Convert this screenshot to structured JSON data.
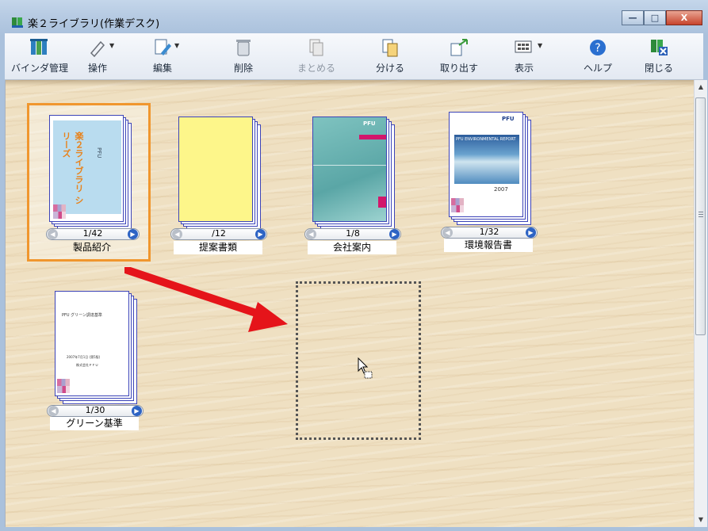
{
  "window": {
    "title": "楽２ライブラリ(作業デスク)",
    "buttons": {
      "minimize": "—",
      "maximize": "□",
      "close": "X"
    }
  },
  "toolbar": {
    "items": [
      {
        "label": "バインダ管理",
        "icon": "binder-icon",
        "enabled": true
      },
      {
        "label": "操作",
        "icon": "wand-icon",
        "enabled": true
      },
      {
        "label": "編集",
        "icon": "edit-icon",
        "enabled": true
      },
      {
        "label": "削除",
        "icon": "trash-icon",
        "enabled": true
      },
      {
        "label": "まとめる",
        "icon": "merge-icon",
        "enabled": false
      },
      {
        "label": "分ける",
        "icon": "split-icon",
        "enabled": true
      },
      {
        "label": "取り出す",
        "icon": "extract-icon",
        "enabled": true
      },
      {
        "label": "表示",
        "icon": "view-icon",
        "enabled": true
      },
      {
        "label": "ヘルプ",
        "icon": "help-icon",
        "enabled": true
      },
      {
        "label": "閉じる",
        "icon": "close-desk-icon",
        "enabled": true
      }
    ]
  },
  "binders": [
    {
      "name": "製品紹介",
      "pages": "1/42",
      "selected": true
    },
    {
      "name": "提案書類",
      "pages": "/12",
      "selected": false
    },
    {
      "name": "会社案内",
      "pages": "1/8",
      "selected": false
    },
    {
      "name": "環境報告書",
      "pages": "1/32",
      "selected": false
    },
    {
      "name": "グリーン基準",
      "pages": "1/30",
      "selected": false
    }
  ],
  "covers": {
    "product_vertical": "楽２ライブラリ シリーズ",
    "product_small": "PFU",
    "company_brand": "PFU",
    "env_brand": "PFU",
    "env_title": "PFU ENVIRONMENTAL REPORT",
    "env_year": "2007",
    "green_title": "PFU グリーン調達基準",
    "green_date": "2007年7月1日 (第5版)",
    "green_company": "株式会社ＰＦＵ"
  },
  "colors": {
    "selection": "#f0962e",
    "arrow": "#e5141a",
    "sheet_border": "#3c44b8"
  }
}
